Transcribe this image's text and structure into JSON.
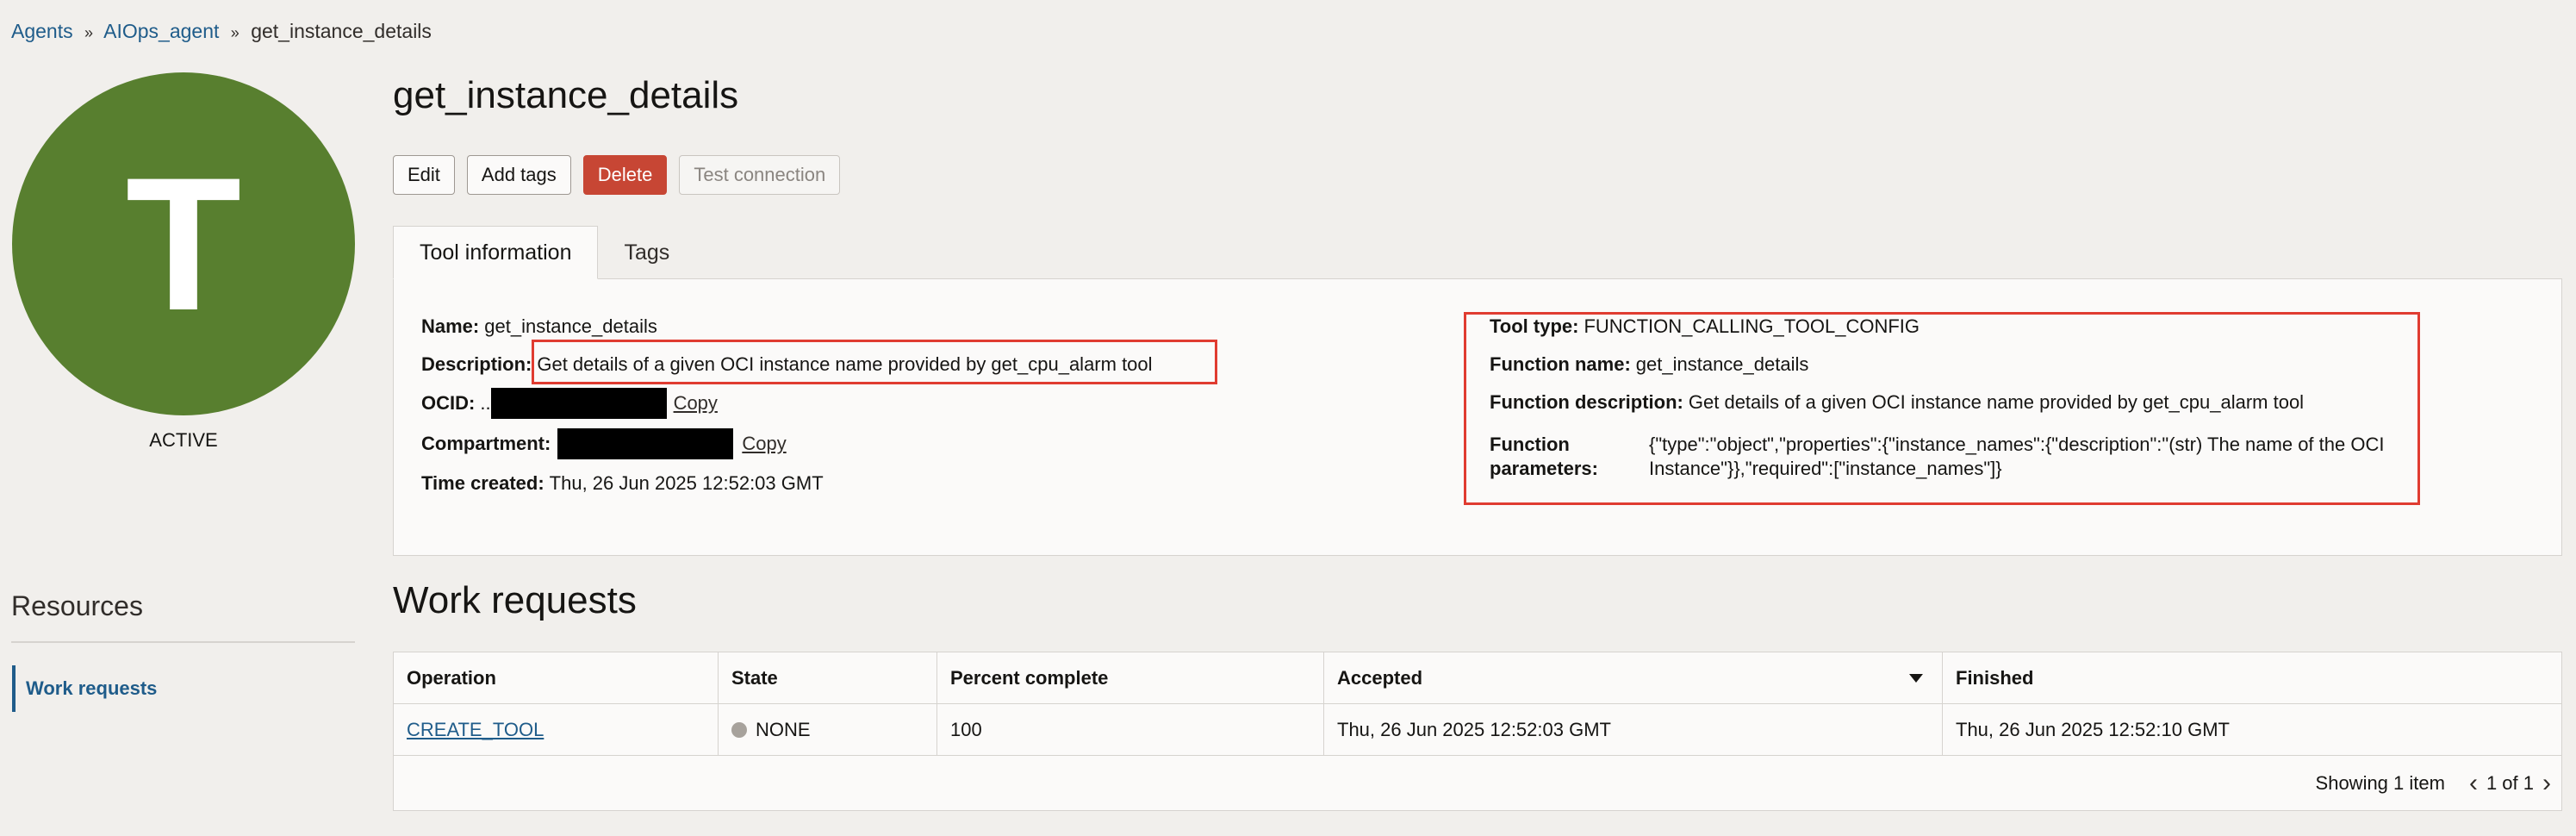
{
  "breadcrumb": {
    "items": [
      "Agents",
      "AIOps_agent",
      "get_instance_details"
    ],
    "separator": "»"
  },
  "avatar": {
    "letter": "T",
    "status": "ACTIVE",
    "color": "#587f2f"
  },
  "resources": {
    "title": "Resources",
    "items": [
      "Work requests"
    ]
  },
  "page": {
    "title": "get_instance_details"
  },
  "actions": {
    "edit": "Edit",
    "add_tags": "Add tags",
    "delete": "Delete",
    "test_connection": "Test connection"
  },
  "tabs": [
    "Tool information",
    "Tags"
  ],
  "info": {
    "name_label": "Name:",
    "name_value": "get_instance_details",
    "description_label": "Description:",
    "description_value": "Get details of a given OCI instance name provided by get_cpu_alarm tool",
    "ocid_label": "OCID:",
    "ocid_prefix": "..",
    "ocid_copy": "Copy",
    "compartment_label": "Compartment:",
    "compartment_copy": "Copy",
    "time_created_label": "Time created:",
    "time_created_value": "Thu, 26 Jun 2025 12:52:03 GMT",
    "tool_type_label": "Tool type:",
    "tool_type_value": "FUNCTION_CALLING_TOOL_CONFIG",
    "function_name_label": "Function name:",
    "function_name_value": "get_instance_details",
    "function_description_label": "Function description:",
    "function_description_value": "Get details of a given OCI instance name provided by get_cpu_alarm tool",
    "function_parameters_label": "Function parameters:",
    "function_parameters_value": "{\"type\":\"object\",\"properties\":{\"instance_names\":{\"description\":\"(str) The name of the OCI Instance\"}},\"required\":[\"instance_names\"]}"
  },
  "work_requests": {
    "title": "Work requests",
    "columns": [
      "Operation",
      "State",
      "Percent complete",
      "Accepted",
      "Finished"
    ],
    "rows": [
      {
        "operation": "CREATE_TOOL",
        "state": "NONE",
        "percent": "100",
        "accepted": "Thu, 26 Jun 2025 12:52:03 GMT",
        "finished": "Thu, 26 Jun 2025 12:52:10 GMT"
      }
    ],
    "showing": "Showing 1 item",
    "page": "1 of 1"
  },
  "colors": {
    "link": "#1f5c8a",
    "danger": "#c74634",
    "highlight": "#e03c31"
  }
}
